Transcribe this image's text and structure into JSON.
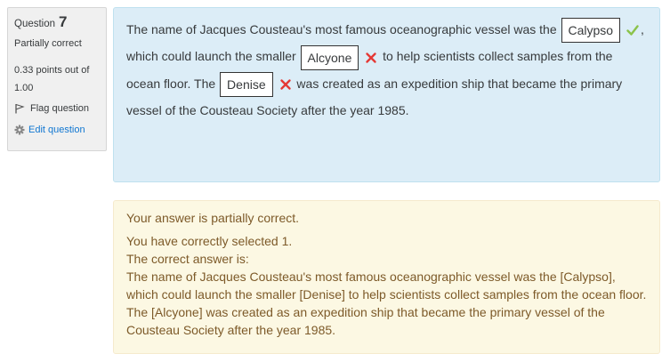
{
  "info": {
    "question_label": "Question",
    "question_number": "7",
    "state": "Partially correct",
    "grade": "0.33 points out of 1.00",
    "flag_label": "Flag question",
    "edit_label": "Edit question",
    "flag_icon": "flag-icon",
    "edit_icon": "gear-icon"
  },
  "question": {
    "text1": "The name of Jacques Cousteau's most famous oceanographic vessel was the",
    "answer1": "Calypso",
    "text2": ", which could launch the smaller",
    "answer2": "Alcyone",
    "text3": "to help scientists collect samples from the ocean floor.  The",
    "answer3": "Denise",
    "text4": "was created as an expedition ship that became the primary vessel of the Cousteau Society after the year 1985.",
    "marks": [
      "correct-check-icon",
      "incorrect-cross-icon",
      "incorrect-cross-icon"
    ]
  },
  "feedback": {
    "summary": "Your answer is partially correct.",
    "selected": "You have correctly selected 1.",
    "correct_heading": "The correct answer is:",
    "correct_text": "The name of Jacques Cousteau's most famous oceanographic vessel was the [Calypso], which could launch the smaller [Denise] to help scientists collect samples from the ocean floor.  The [Alcyone] was created as an expedition ship that became the primary vessel of the Cousteau Society after the year 1985."
  },
  "colors": {
    "content_bg": "#dcedf7",
    "feedback_bg": "#fcf8e3",
    "feedback_text": "#7d5a29",
    "correct": "#8bc34a",
    "incorrect": "#e53935",
    "link": "#1177d1"
  }
}
